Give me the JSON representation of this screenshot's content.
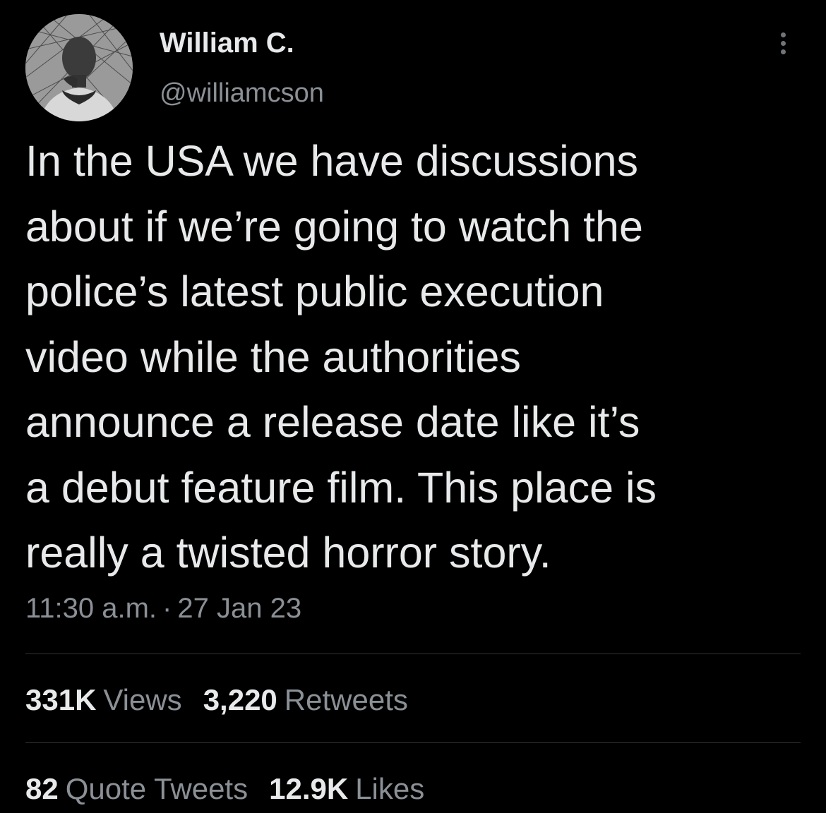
{
  "author": {
    "name": "William C.",
    "handle": "@williamcson"
  },
  "tweet": {
    "lines": [
      "In the USA we have discussions",
      "about if we’re going to watch the",
      "police’s latest public execution",
      "video while the authorities",
      "announce a release date like it’s",
      "a debut feature film. This place is",
      "really a twisted horror story."
    ],
    "time": "11:30 a.m.",
    "separator": "·",
    "date": "27 Jan 23"
  },
  "stats": {
    "views_count": "331K",
    "views_label": "Views",
    "retweets_count": "3,220",
    "retweets_label": "Retweets",
    "quotes_count": "82",
    "quotes_label": "Quote Tweets",
    "likes_count": "12.9K",
    "likes_label": "Likes"
  },
  "icons": {
    "more": "more-vertical-icon"
  },
  "colors": {
    "background": "#000000",
    "primary_text": "#e7e9ea",
    "secondary_text": "#8b9096",
    "divider": "#2f3336"
  }
}
